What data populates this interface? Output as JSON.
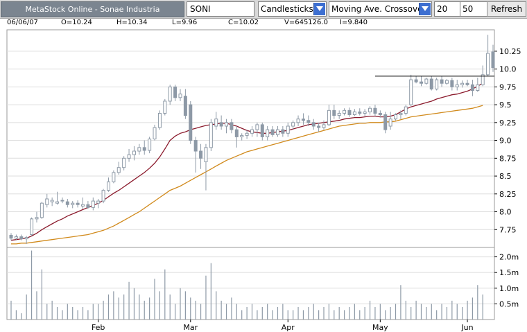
{
  "toolbar": {
    "title": "MetaStock Online - Sonae Industria",
    "symbol": "SONI",
    "chart_style": "Candlesticks",
    "indicator": "Moving Ave. Crossover",
    "period_fast": "20",
    "period_slow": "50",
    "refresh_label": "Refresh"
  },
  "info": {
    "date": "06/06/07",
    "open": "O=10.24",
    "high": "H=10.34",
    "low": "L=9.96",
    "close": "C=10.02",
    "volume": "V=645126.0",
    "indicator": "I=9.840"
  },
  "chart_data": {
    "type": "candlestick",
    "x_ticks": [
      "Feb",
      "Mar",
      "Apr",
      "May",
      "Jun"
    ],
    "price_ticks": [
      "7.75",
      "8.0",
      "8.25",
      "8.5",
      "8.75",
      "9.0",
      "9.25",
      "9.5",
      "9.75",
      "10.0",
      "10.25"
    ],
    "volume_ticks": [
      "0.5m",
      "1.0m",
      "1.5m",
      "2.0m"
    ],
    "price_range": [
      7.5,
      10.55
    ],
    "volume_range": [
      0,
      2.3
    ],
    "horizontal_level": 9.9,
    "colors": {
      "candle": "#8d99a6",
      "ma_fast": "#8b1a2c",
      "ma_slow": "#d18a1c",
      "level": "#000000",
      "grid": "#dddddd"
    },
    "candles": [
      {
        "o": 7.67,
        "h": 7.7,
        "l": 7.6,
        "c": 7.63
      },
      {
        "o": 7.63,
        "h": 7.68,
        "l": 7.6,
        "c": 7.65
      },
      {
        "o": 7.65,
        "h": 7.68,
        "l": 7.6,
        "c": 7.62
      },
      {
        "o": 7.62,
        "h": 7.66,
        "l": 7.55,
        "c": 7.64
      },
      {
        "o": 7.68,
        "h": 7.92,
        "l": 7.66,
        "c": 7.9
      },
      {
        "o": 7.9,
        "h": 8.0,
        "l": 7.85,
        "c": 7.92
      },
      {
        "o": 7.92,
        "h": 8.14,
        "l": 7.9,
        "c": 8.12
      },
      {
        "o": 8.1,
        "h": 8.25,
        "l": 8.06,
        "c": 8.18
      },
      {
        "o": 8.14,
        "h": 8.2,
        "l": 8.08,
        "c": 8.16
      },
      {
        "o": 8.12,
        "h": 8.28,
        "l": 8.1,
        "c": 8.14
      },
      {
        "o": 8.16,
        "h": 8.2,
        "l": 8.12,
        "c": 8.15
      },
      {
        "o": 8.14,
        "h": 8.18,
        "l": 8.06,
        "c": 8.1
      },
      {
        "o": 8.1,
        "h": 8.15,
        "l": 8.05,
        "c": 8.12
      },
      {
        "o": 8.12,
        "h": 8.16,
        "l": 8.06,
        "c": 8.1
      },
      {
        "o": 8.08,
        "h": 8.2,
        "l": 8.04,
        "c": 8.1
      },
      {
        "o": 8.1,
        "h": 8.15,
        "l": 8.04,
        "c": 8.06
      },
      {
        "o": 8.06,
        "h": 8.2,
        "l": 8.02,
        "c": 8.15
      },
      {
        "o": 8.12,
        "h": 8.18,
        "l": 8.05,
        "c": 8.15
      },
      {
        "o": 8.15,
        "h": 8.32,
        "l": 8.12,
        "c": 8.3
      },
      {
        "o": 8.3,
        "h": 8.48,
        "l": 8.28,
        "c": 8.42
      },
      {
        "o": 8.42,
        "h": 8.58,
        "l": 8.4,
        "c": 8.55
      },
      {
        "o": 8.55,
        "h": 8.7,
        "l": 8.52,
        "c": 8.62
      },
      {
        "o": 8.62,
        "h": 8.78,
        "l": 8.58,
        "c": 8.75
      },
      {
        "o": 8.75,
        "h": 8.88,
        "l": 8.7,
        "c": 8.8
      },
      {
        "o": 8.8,
        "h": 8.92,
        "l": 8.72,
        "c": 8.85
      },
      {
        "o": 8.85,
        "h": 8.95,
        "l": 8.8,
        "c": 8.9
      },
      {
        "o": 8.9,
        "h": 9.0,
        "l": 8.8,
        "c": 8.86
      },
      {
        "o": 8.86,
        "h": 9.05,
        "l": 8.82,
        "c": 9.02
      },
      {
        "o": 9.02,
        "h": 9.22,
        "l": 9.0,
        "c": 9.18
      },
      {
        "o": 9.18,
        "h": 9.42,
        "l": 9.15,
        "c": 9.38
      },
      {
        "o": 9.38,
        "h": 9.58,
        "l": 9.35,
        "c": 9.55
      },
      {
        "o": 9.55,
        "h": 9.78,
        "l": 9.5,
        "c": 9.75
      },
      {
        "o": 9.75,
        "h": 9.78,
        "l": 9.55,
        "c": 9.6
      },
      {
        "o": 9.6,
        "h": 9.72,
        "l": 9.55,
        "c": 9.65
      },
      {
        "o": 9.62,
        "h": 9.72,
        "l": 9.3,
        "c": 9.35
      },
      {
        "o": 9.5,
        "h": 9.55,
        "l": 8.95,
        "c": 9.0
      },
      {
        "o": 9.0,
        "h": 9.05,
        "l": 8.55,
        "c": 8.85
      },
      {
        "o": 8.85,
        "h": 8.95,
        "l": 8.6,
        "c": 8.75
      },
      {
        "o": 8.7,
        "h": 8.95,
        "l": 8.3,
        "c": 8.9
      },
      {
        "o": 8.9,
        "h": 9.3,
        "l": 8.85,
        "c": 9.25
      },
      {
        "o": 9.2,
        "h": 9.4,
        "l": 9.15,
        "c": 9.3
      },
      {
        "o": 9.25,
        "h": 9.35,
        "l": 9.15,
        "c": 9.2
      },
      {
        "o": 9.2,
        "h": 9.3,
        "l": 9.1,
        "c": 9.25
      },
      {
        "o": 9.25,
        "h": 9.3,
        "l": 9.1,
        "c": 9.15
      },
      {
        "o": 9.15,
        "h": 9.2,
        "l": 8.9,
        "c": 9.05
      },
      {
        "o": 9.05,
        "h": 9.1,
        "l": 9.0,
        "c": 9.07
      },
      {
        "o": 9.07,
        "h": 9.15,
        "l": 9.02,
        "c": 9.1
      },
      {
        "o": 9.1,
        "h": 9.2,
        "l": 9.05,
        "c": 9.15
      },
      {
        "o": 9.15,
        "h": 9.25,
        "l": 9.05,
        "c": 9.22
      },
      {
        "o": 9.22,
        "h": 9.25,
        "l": 9.0,
        "c": 9.05
      },
      {
        "o": 9.05,
        "h": 9.2,
        "l": 9.0,
        "c": 9.15
      },
      {
        "o": 9.15,
        "h": 9.2,
        "l": 9.05,
        "c": 9.08
      },
      {
        "o": 9.08,
        "h": 9.2,
        "l": 9.05,
        "c": 9.15
      },
      {
        "o": 9.15,
        "h": 9.2,
        "l": 9.05,
        "c": 9.1
      },
      {
        "o": 9.1,
        "h": 9.25,
        "l": 9.05,
        "c": 9.2
      },
      {
        "o": 9.2,
        "h": 9.28,
        "l": 9.15,
        "c": 9.25
      },
      {
        "o": 9.25,
        "h": 9.35,
        "l": 9.2,
        "c": 9.3
      },
      {
        "o": 9.3,
        "h": 9.38,
        "l": 9.22,
        "c": 9.28
      },
      {
        "o": 9.28,
        "h": 9.35,
        "l": 9.2,
        "c": 9.25
      },
      {
        "o": 9.25,
        "h": 9.3,
        "l": 9.15,
        "c": 9.2
      },
      {
        "o": 9.2,
        "h": 9.25,
        "l": 9.12,
        "c": 9.18
      },
      {
        "o": 9.18,
        "h": 9.28,
        "l": 9.15,
        "c": 9.22
      },
      {
        "o": 9.22,
        "h": 9.5,
        "l": 9.2,
        "c": 9.42
      },
      {
        "o": 9.42,
        "h": 9.5,
        "l": 9.3,
        "c": 9.35
      },
      {
        "o": 9.35,
        "h": 9.42,
        "l": 9.3,
        "c": 9.38
      },
      {
        "o": 9.38,
        "h": 9.45,
        "l": 9.35,
        "c": 9.42
      },
      {
        "o": 9.42,
        "h": 9.46,
        "l": 9.33,
        "c": 9.36
      },
      {
        "o": 9.36,
        "h": 9.44,
        "l": 9.34,
        "c": 9.4
      },
      {
        "o": 9.4,
        "h": 9.45,
        "l": 9.35,
        "c": 9.38
      },
      {
        "o": 9.38,
        "h": 9.44,
        "l": 9.34,
        "c": 9.4
      },
      {
        "o": 9.4,
        "h": 9.48,
        "l": 9.36,
        "c": 9.45
      },
      {
        "o": 9.45,
        "h": 9.5,
        "l": 9.34,
        "c": 9.38
      },
      {
        "o": 9.38,
        "h": 9.42,
        "l": 9.32,
        "c": 9.36
      },
      {
        "o": 9.36,
        "h": 9.4,
        "l": 9.1,
        "c": 9.15
      },
      {
        "o": 9.2,
        "h": 9.4,
        "l": 9.15,
        "c": 9.3
      },
      {
        "o": 9.3,
        "h": 9.38,
        "l": 9.28,
        "c": 9.36
      },
      {
        "o": 9.36,
        "h": 9.42,
        "l": 9.3,
        "c": 9.38
      },
      {
        "o": 9.38,
        "h": 9.5,
        "l": 9.35,
        "c": 9.47
      },
      {
        "o": 9.5,
        "h": 9.92,
        "l": 9.48,
        "c": 9.85
      },
      {
        "o": 9.85,
        "h": 9.9,
        "l": 9.8,
        "c": 9.82
      },
      {
        "o": 9.82,
        "h": 9.9,
        "l": 9.76,
        "c": 9.8
      },
      {
        "o": 9.8,
        "h": 9.88,
        "l": 9.78,
        "c": 9.86
      },
      {
        "o": 9.86,
        "h": 9.9,
        "l": 9.7,
        "c": 9.72
      },
      {
        "o": 9.72,
        "h": 9.88,
        "l": 9.7,
        "c": 9.85
      },
      {
        "o": 9.85,
        "h": 9.9,
        "l": 9.75,
        "c": 9.8
      },
      {
        "o": 9.8,
        "h": 9.86,
        "l": 9.78,
        "c": 9.84
      },
      {
        "o": 9.84,
        "h": 9.88,
        "l": 9.7,
        "c": 9.75
      },
      {
        "o": 9.75,
        "h": 9.85,
        "l": 9.7,
        "c": 9.78
      },
      {
        "o": 9.78,
        "h": 9.84,
        "l": 9.74,
        "c": 9.8
      },
      {
        "o": 9.8,
        "h": 9.85,
        "l": 9.76,
        "c": 9.78
      },
      {
        "o": 9.78,
        "h": 9.85,
        "l": 9.62,
        "c": 9.7
      },
      {
        "o": 9.7,
        "h": 9.88,
        "l": 9.68,
        "c": 9.78
      },
      {
        "o": 9.78,
        "h": 10.05,
        "l": 9.76,
        "c": 9.92
      },
      {
        "o": 9.92,
        "h": 10.48,
        "l": 9.9,
        "c": 10.22
      },
      {
        "o": 10.24,
        "h": 10.34,
        "l": 9.96,
        "c": 10.02
      }
    ],
    "ma_fast": [
      7.6,
      7.61,
      7.62,
      7.63,
      7.66,
      7.7,
      7.75,
      7.79,
      7.83,
      7.87,
      7.9,
      7.94,
      7.97,
      8.0,
      8.03,
      8.06,
      8.09,
      8.12,
      8.16,
      8.21,
      8.26,
      8.3,
      8.35,
      8.4,
      8.45,
      8.5,
      8.55,
      8.61,
      8.68,
      8.77,
      8.88,
      9.0,
      9.06,
      9.1,
      9.12,
      9.15,
      9.17,
      9.19,
      9.21,
      9.22,
      9.23,
      9.24,
      9.24,
      9.22,
      9.2,
      9.17,
      9.14,
      9.12,
      9.11,
      9.1,
      9.1,
      9.11,
      9.12,
      9.13,
      9.14,
      9.16,
      9.18,
      9.2,
      9.22,
      9.23,
      9.24,
      9.25,
      9.26,
      9.27,
      9.28,
      9.3,
      9.31,
      9.32,
      9.32,
      9.33,
      9.34,
      9.34,
      9.33,
      9.33,
      9.34,
      9.36,
      9.4,
      9.44,
      9.47,
      9.49,
      9.51,
      9.53,
      9.55,
      9.58,
      9.6,
      9.62,
      9.64,
      9.65,
      9.67,
      9.69,
      9.72,
      9.76,
      9.8
    ],
    "ma_slow": [
      7.55,
      7.55,
      7.56,
      7.56,
      7.57,
      7.58,
      7.59,
      7.6,
      7.61,
      7.62,
      7.63,
      7.64,
      7.65,
      7.66,
      7.67,
      7.68,
      7.7,
      7.72,
      7.74,
      7.77,
      7.8,
      7.84,
      7.88,
      7.92,
      7.96,
      8.0,
      8.05,
      8.1,
      8.15,
      8.2,
      8.25,
      8.3,
      8.33,
      8.36,
      8.4,
      8.44,
      8.48,
      8.52,
      8.56,
      8.6,
      8.64,
      8.68,
      8.72,
      8.75,
      8.78,
      8.81,
      8.84,
      8.86,
      8.88,
      8.9,
      8.92,
      8.94,
      8.96,
      8.98,
      9.0,
      9.02,
      9.04,
      9.06,
      9.08,
      9.1,
      9.12,
      9.14,
      9.16,
      9.18,
      9.2,
      9.21,
      9.22,
      9.23,
      9.24,
      9.24,
      9.25,
      9.25,
      9.25,
      9.26,
      9.26,
      9.27,
      9.29,
      9.31,
      9.33,
      9.34,
      9.35,
      9.36,
      9.37,
      9.38,
      9.39,
      9.4,
      9.41,
      9.42,
      9.43,
      9.44,
      9.45,
      9.47,
      9.49
    ],
    "volume": [
      0.6,
      0.3,
      0.2,
      0.8,
      2.2,
      0.9,
      1.6,
      0.5,
      0.6,
      0.4,
      0.3,
      0.5,
      0.4,
      0.3,
      0.4,
      0.3,
      0.5,
      0.5,
      0.6,
      0.8,
      0.9,
      0.7,
      0.8,
      1.2,
      1.0,
      0.8,
      0.6,
      0.7,
      1.3,
      0.9,
      1.6,
      0.8,
      0.5,
      1.0,
      0.9,
      0.7,
      0.6,
      0.5,
      1.4,
      1.8,
      0.9,
      0.6,
      0.5,
      0.7,
      0.5,
      0.3,
      0.4,
      0.5,
      0.3,
      0.4,
      0.5,
      0.3,
      0.4,
      0.5,
      0.3,
      0.3,
      0.4,
      0.3,
      0.4,
      0.5,
      0.3,
      0.4,
      0.5,
      0.3,
      0.4,
      0.3,
      0.4,
      0.5,
      0.3,
      0.4,
      0.6,
      0.4,
      0.5,
      0.3,
      0.4,
      0.5,
      1.1,
      0.6,
      0.4,
      0.6,
      0.5,
      0.4,
      0.5,
      0.3,
      0.5,
      0.4,
      0.6,
      0.5,
      0.4,
      0.6,
      0.7,
      1.1,
      0.8
    ]
  }
}
